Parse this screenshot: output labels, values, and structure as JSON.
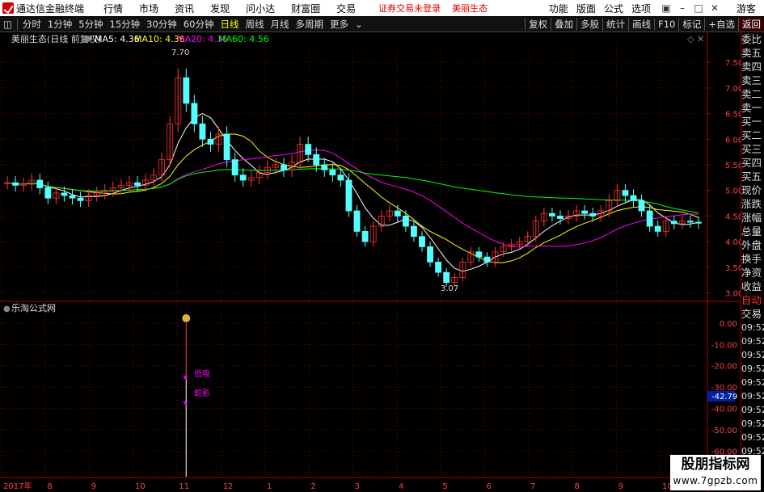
{
  "menubar": {
    "app_title": "通达信金融终端",
    "items": [
      "行情",
      "市场",
      "资讯",
      "发现",
      "问小达",
      "财富圈",
      "交易"
    ],
    "warning": "证券交易未登录",
    "stock_name": "美丽生态",
    "right_items": [
      "功能",
      "版面",
      "公式",
      "选项"
    ],
    "guest": "游客"
  },
  "toolbar": {
    "items": [
      "分时",
      "1分钟",
      "5分钟",
      "15分钟",
      "30分钟",
      "60分钟",
      "日线",
      "周线",
      "月线",
      "多周期",
      "更多"
    ],
    "active": "日线",
    "right_items": [
      "复权",
      "叠加",
      "多股",
      "统计",
      "画线",
      "F10",
      "标记",
      "+自选",
      "返回"
    ]
  },
  "chart_header": {
    "title": "美丽生态(日线 前复权)",
    "ma5": "MA5: 4.36",
    "ma10": "MA10: 4.36",
    "ma20": "MA20: 4.36",
    "ma60": "MA60: 4.56"
  },
  "indicator_header": {
    "title": "乐淘公式网"
  },
  "annotations": {
    "high": "7.70",
    "low": "3.07",
    "signal1": "低吸",
    "signal2": "蛇影",
    "indicator_value": "-42.79"
  },
  "side_panel": {
    "labels": [
      "委比",
      "卖五",
      "卖四",
      "卖三",
      "卖二",
      "卖一",
      "买一",
      "买二",
      "买三",
      "买四",
      "买五",
      "现价",
      "涨跌",
      "涨幅",
      "总量",
      "外盘",
      "换手",
      "净资",
      "收益"
    ],
    "auto_labels": [
      "自动",
      "交易"
    ],
    "times": [
      "09:52",
      "09:52",
      "09:52",
      "09:52",
      "09:52",
      "09:52",
      "09:52",
      "09:52",
      "09:52",
      "09:52"
    ]
  },
  "watermark": {
    "line1": "股朋指标网",
    "line2": "www.7gpzb.com"
  },
  "colors": {
    "up": "#ff3232",
    "down": "#54ffff",
    "ma5": "#ffffff",
    "ma10": "#ffff00",
    "ma20": "#ff00ff",
    "ma60": "#00ff00",
    "grid": "#7a0000"
  },
  "chart_data": {
    "type": "candlestick",
    "price_axis": {
      "ticks": [
        3.0,
        3.5,
        4.0,
        4.5,
        5.0,
        5.5,
        6.0,
        6.5,
        7.0,
        7.5
      ],
      "range": [
        2.85,
        7.85
      ]
    },
    "indicator_axis": {
      "ticks": [
        0.0,
        -10.0,
        -20.0,
        -30.0,
        -40.0,
        -50.0,
        -60.0,
        -70.0
      ],
      "range": [
        -72,
        3
      ]
    },
    "x_labels": [
      "2017年",
      "8",
      "9",
      "10",
      "11",
      "12",
      "1",
      "2",
      "3",
      "4",
      "5",
      "6",
      "7",
      "8",
      "9",
      "10"
    ],
    "close_series": [
      5.15,
      5.1,
      5.12,
      5.2,
      5.05,
      4.85,
      4.95,
      4.9,
      4.85,
      4.8,
      4.9,
      4.95,
      5.0,
      5.05,
      5.1,
      5.15,
      5.1,
      5.2,
      5.3,
      5.6,
      6.3,
      7.2,
      6.7,
      6.3,
      6.0,
      5.9,
      6.1,
      5.6,
      5.3,
      5.2,
      5.25,
      5.35,
      5.45,
      5.5,
      5.4,
      5.55,
      5.9,
      5.7,
      5.5,
      5.4,
      5.3,
      5.2,
      4.6,
      4.2,
      4.0,
      4.3,
      4.5,
      4.6,
      4.5,
      4.3,
      4.1,
      3.9,
      3.6,
      3.4,
      3.2,
      3.3,
      3.6,
      3.8,
      3.7,
      3.6,
      3.8,
      3.9,
      3.95,
      4.0,
      4.1,
      4.4,
      4.55,
      4.5,
      4.45,
      4.5,
      4.6,
      4.55,
      4.5,
      4.6,
      4.8,
      5.0,
      4.9,
      4.8,
      4.6,
      4.3,
      4.2,
      4.4,
      4.35,
      4.4,
      4.38,
      4.36
    ]
  }
}
